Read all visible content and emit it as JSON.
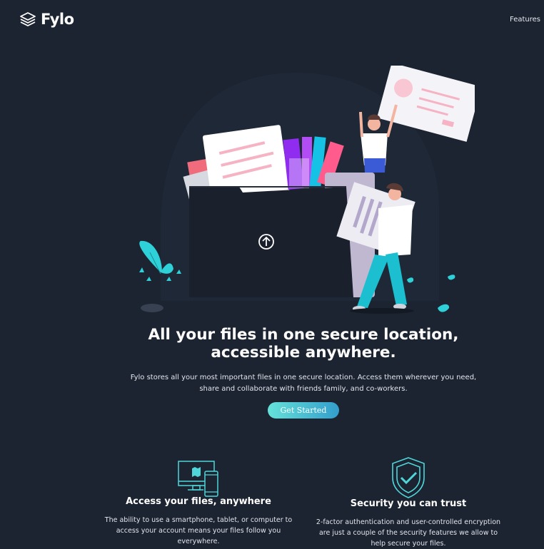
{
  "brand": {
    "name": "Fylo",
    "logo_icon": "stacked-layers-icon"
  },
  "nav": {
    "items": [
      {
        "label": "Features"
      }
    ]
  },
  "hero": {
    "illustration_icon": "upload-arrow-icon",
    "title_line1": "All your files in one secure location,",
    "title_line2": "accessible anywhere.",
    "text_line1": "Fylo stores all your most important files in one secure location. Access them wherever you need,",
    "text_line2": "share and collaborate with friends family, and co-workers.",
    "cta_label": "Get Started"
  },
  "features": [
    {
      "icon": "devices-icon",
      "title": "Access your files, anywhere",
      "text_lines": [
        "The ability to use a smartphone, tablet, or computer to",
        "access your account means your files follow you",
        "everywhere."
      ]
    },
    {
      "icon": "shield-check-icon",
      "title": "Security you can trust",
      "text_lines": [
        "2-factor authentication and user-controlled encryption",
        "are just a couple of the security features we allow to",
        "help secure your files."
      ]
    }
  ],
  "colors": {
    "background": "#1c2331",
    "accent_start": "#65e2d9",
    "accent_end": "#339ecc",
    "text": "#ffffff"
  }
}
